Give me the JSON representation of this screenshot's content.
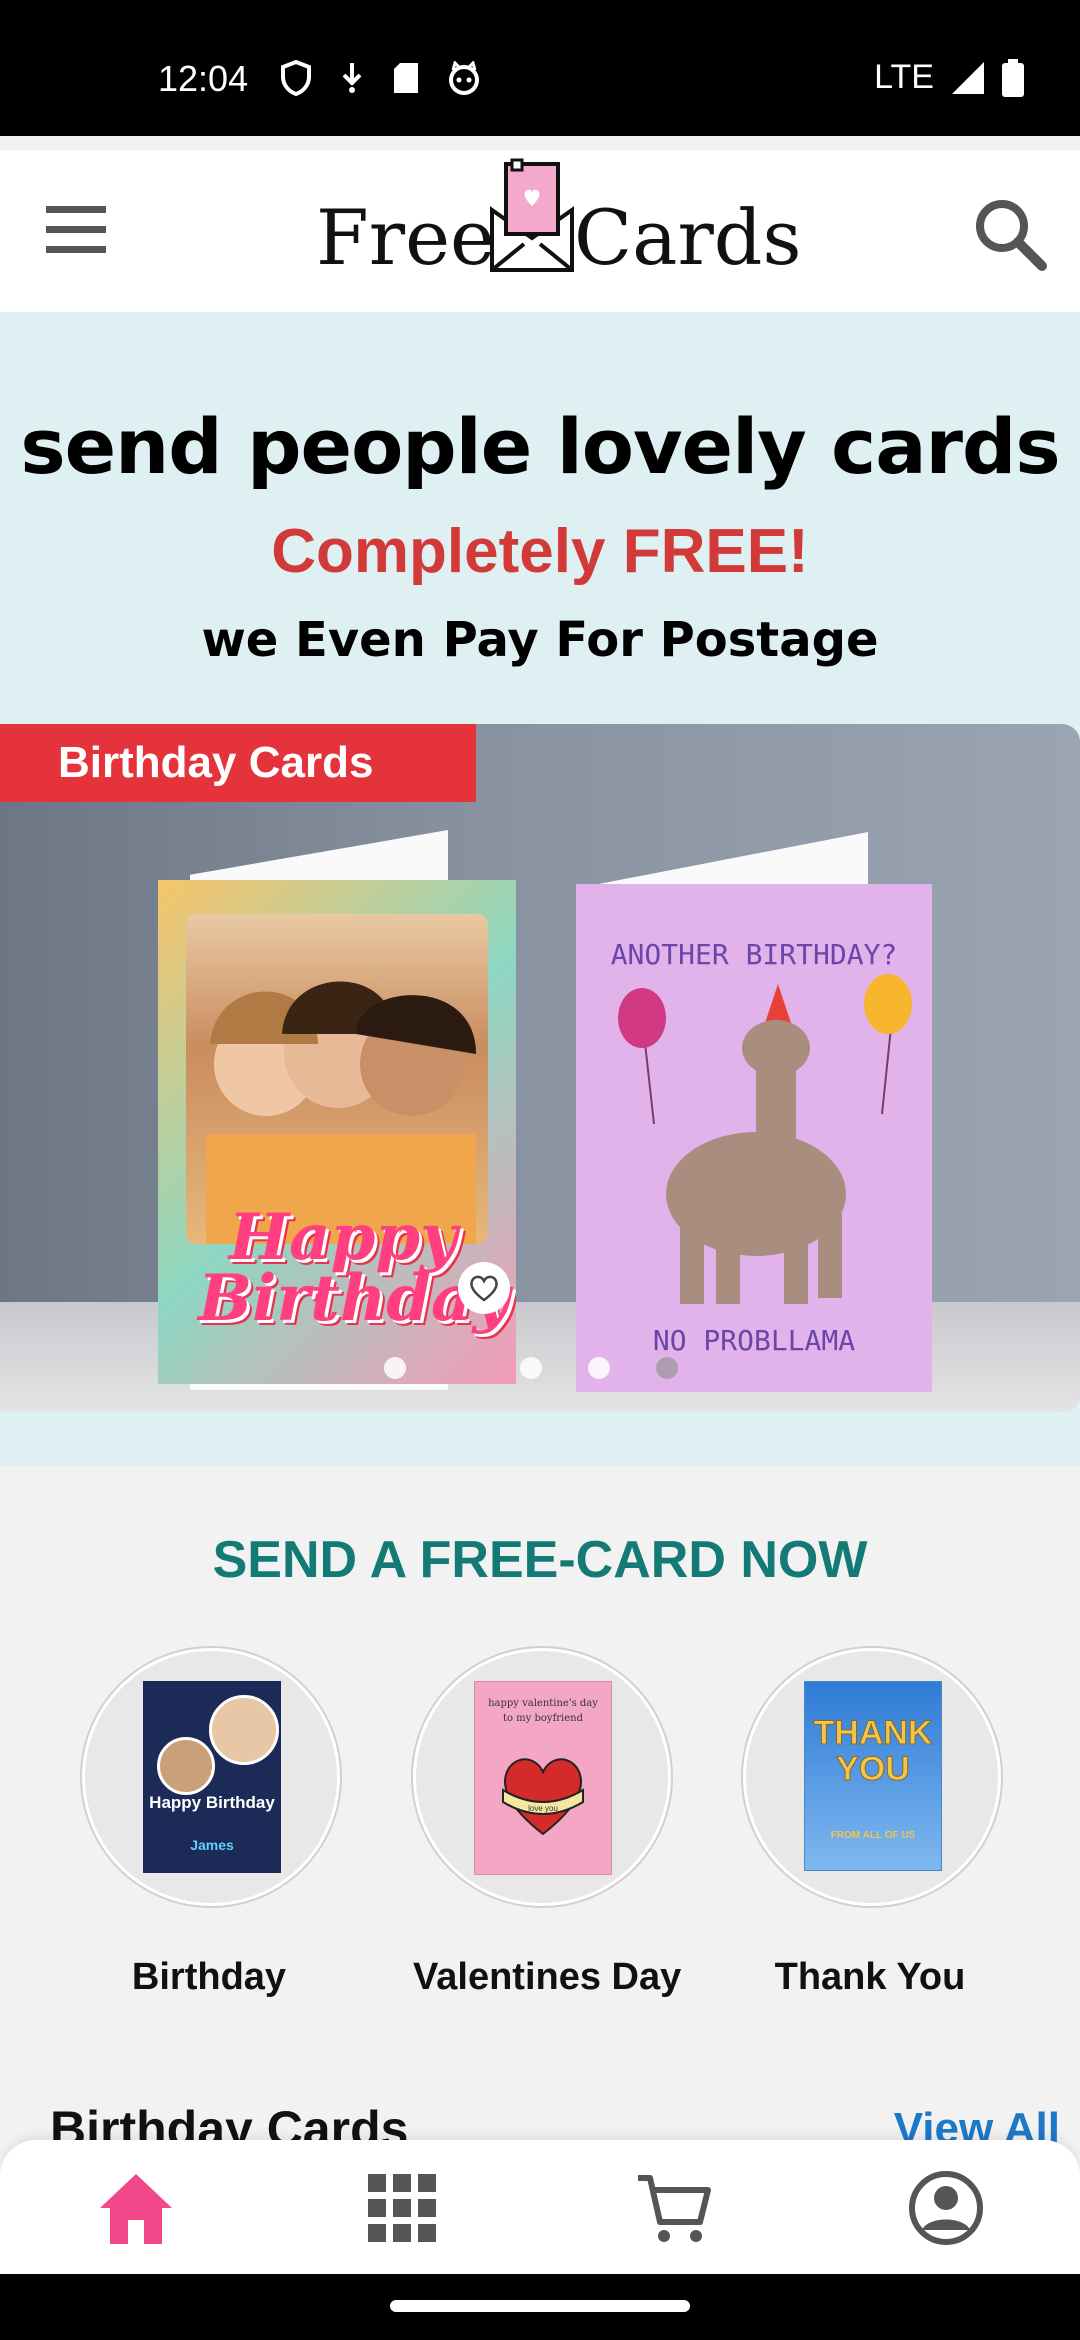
{
  "status_bar": {
    "time": "12:04",
    "network": "LTE"
  },
  "header": {
    "logo_left": "Free",
    "logo_right": "Cards"
  },
  "hero": {
    "title": "send people lovely cards",
    "subtitle": "Completely FREE!",
    "tagline": "we Even Pay For Postage"
  },
  "banner": {
    "tag": "Birthday Cards",
    "card1_text_top": "Happy",
    "card1_text_bottom": "Birthday",
    "card2_text_top": "ANOTHER BIRTHDAY?",
    "card2_text_bottom": "NO PROBLLAMA",
    "slide_count": 5,
    "active_slide": 2
  },
  "categories": {
    "title": "SEND A FREE-CARD NOW",
    "items": [
      {
        "label": "Birthday",
        "thumb_text": "Happy Birthday",
        "thumb_name": "James"
      },
      {
        "label": "Valentines Day",
        "thumb_text": "happy valentine's day to my boyfriend",
        "thumb_banner": "love you"
      },
      {
        "label": "Thank You",
        "thumb_text": "THANK YOU",
        "thumb_small": "FROM ALL OF US"
      }
    ]
  },
  "section": {
    "heading": "Birthday Cards",
    "view_all": "View All"
  },
  "nav": {
    "items": [
      "home-icon",
      "grid-icon",
      "cart-icon",
      "account-icon"
    ],
    "active_color": "#f0488a",
    "inactive_color": "#555555"
  }
}
